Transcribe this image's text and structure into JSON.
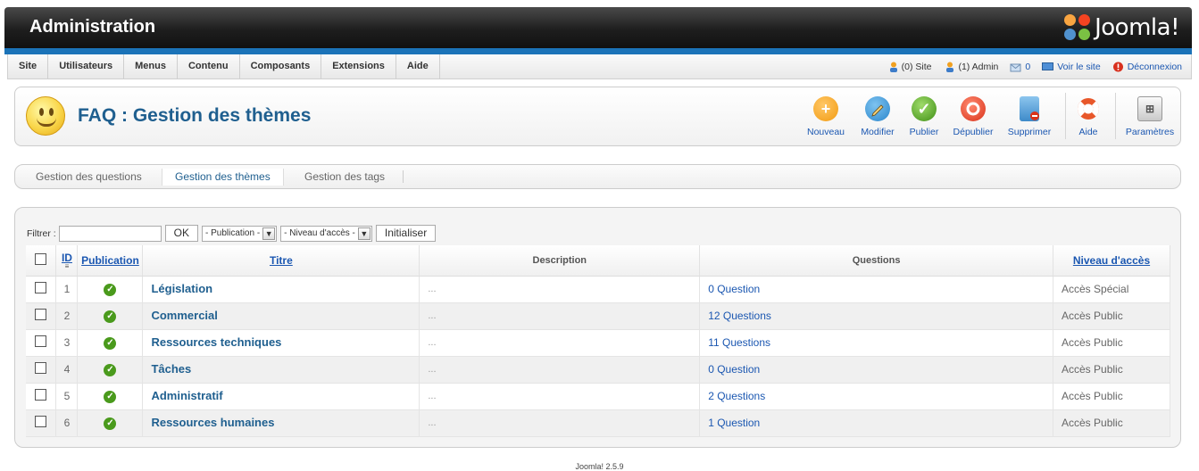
{
  "header": {
    "title": "Administration",
    "logo_text": "Joomla!"
  },
  "menu": [
    "Site",
    "Utilisateurs",
    "Menus",
    "Contenu",
    "Composants",
    "Extensions",
    "Aide"
  ],
  "status": {
    "site_users": "(0) Site",
    "admin_users": "(1) Admin",
    "messages": "0",
    "view_site": "Voir le site",
    "logout": "Déconnexion"
  },
  "page": {
    "title": "FAQ : Gestion des thèmes"
  },
  "toolbar": {
    "new": "Nouveau",
    "edit": "Modifier",
    "publish": "Publier",
    "unpublish": "Dépublier",
    "delete": "Supprimer",
    "help": "Aide",
    "options": "Paramètres"
  },
  "subtabs": [
    "Gestion des questions",
    "Gestion des thèmes",
    "Gestion des tags"
  ],
  "filter": {
    "label": "Filtrer :",
    "search_value": "",
    "ok": "OK",
    "publication_select": "- Publication -",
    "access_select": "- Niveau d'accès -",
    "reset": "Initialiser"
  },
  "table": {
    "headers": {
      "id": "ID",
      "publication": "Publication",
      "title": "Titre",
      "description": "Description",
      "questions": "Questions",
      "access": "Niveau d'accès"
    },
    "rows": [
      {
        "id": "1",
        "title": "Législation",
        "description": "...",
        "questions": "0 Question",
        "access": "Accès Spécial"
      },
      {
        "id": "2",
        "title": "Commercial",
        "description": "...",
        "questions": "12 Questions",
        "access": "Accès Public"
      },
      {
        "id": "3",
        "title": "Ressources techniques",
        "description": "...",
        "questions": "11 Questions",
        "access": "Accès Public"
      },
      {
        "id": "4",
        "title": "Tâches",
        "description": "...",
        "questions": "0 Question",
        "access": "Accès Public"
      },
      {
        "id": "5",
        "title": "Administratif",
        "description": "...",
        "questions": "2 Questions",
        "access": "Accès Public"
      },
      {
        "id": "6",
        "title": "Ressources humaines",
        "description": "...",
        "questions": "1 Question",
        "access": "Accès Public"
      }
    ]
  },
  "footer": {
    "version": "Joomla! 2.5.9"
  },
  "colors": {
    "accent": "#1b73b8",
    "title_blue": "#1f5f8f",
    "link_blue": "#1b57b1",
    "publish_green": "#4a9a1c"
  }
}
